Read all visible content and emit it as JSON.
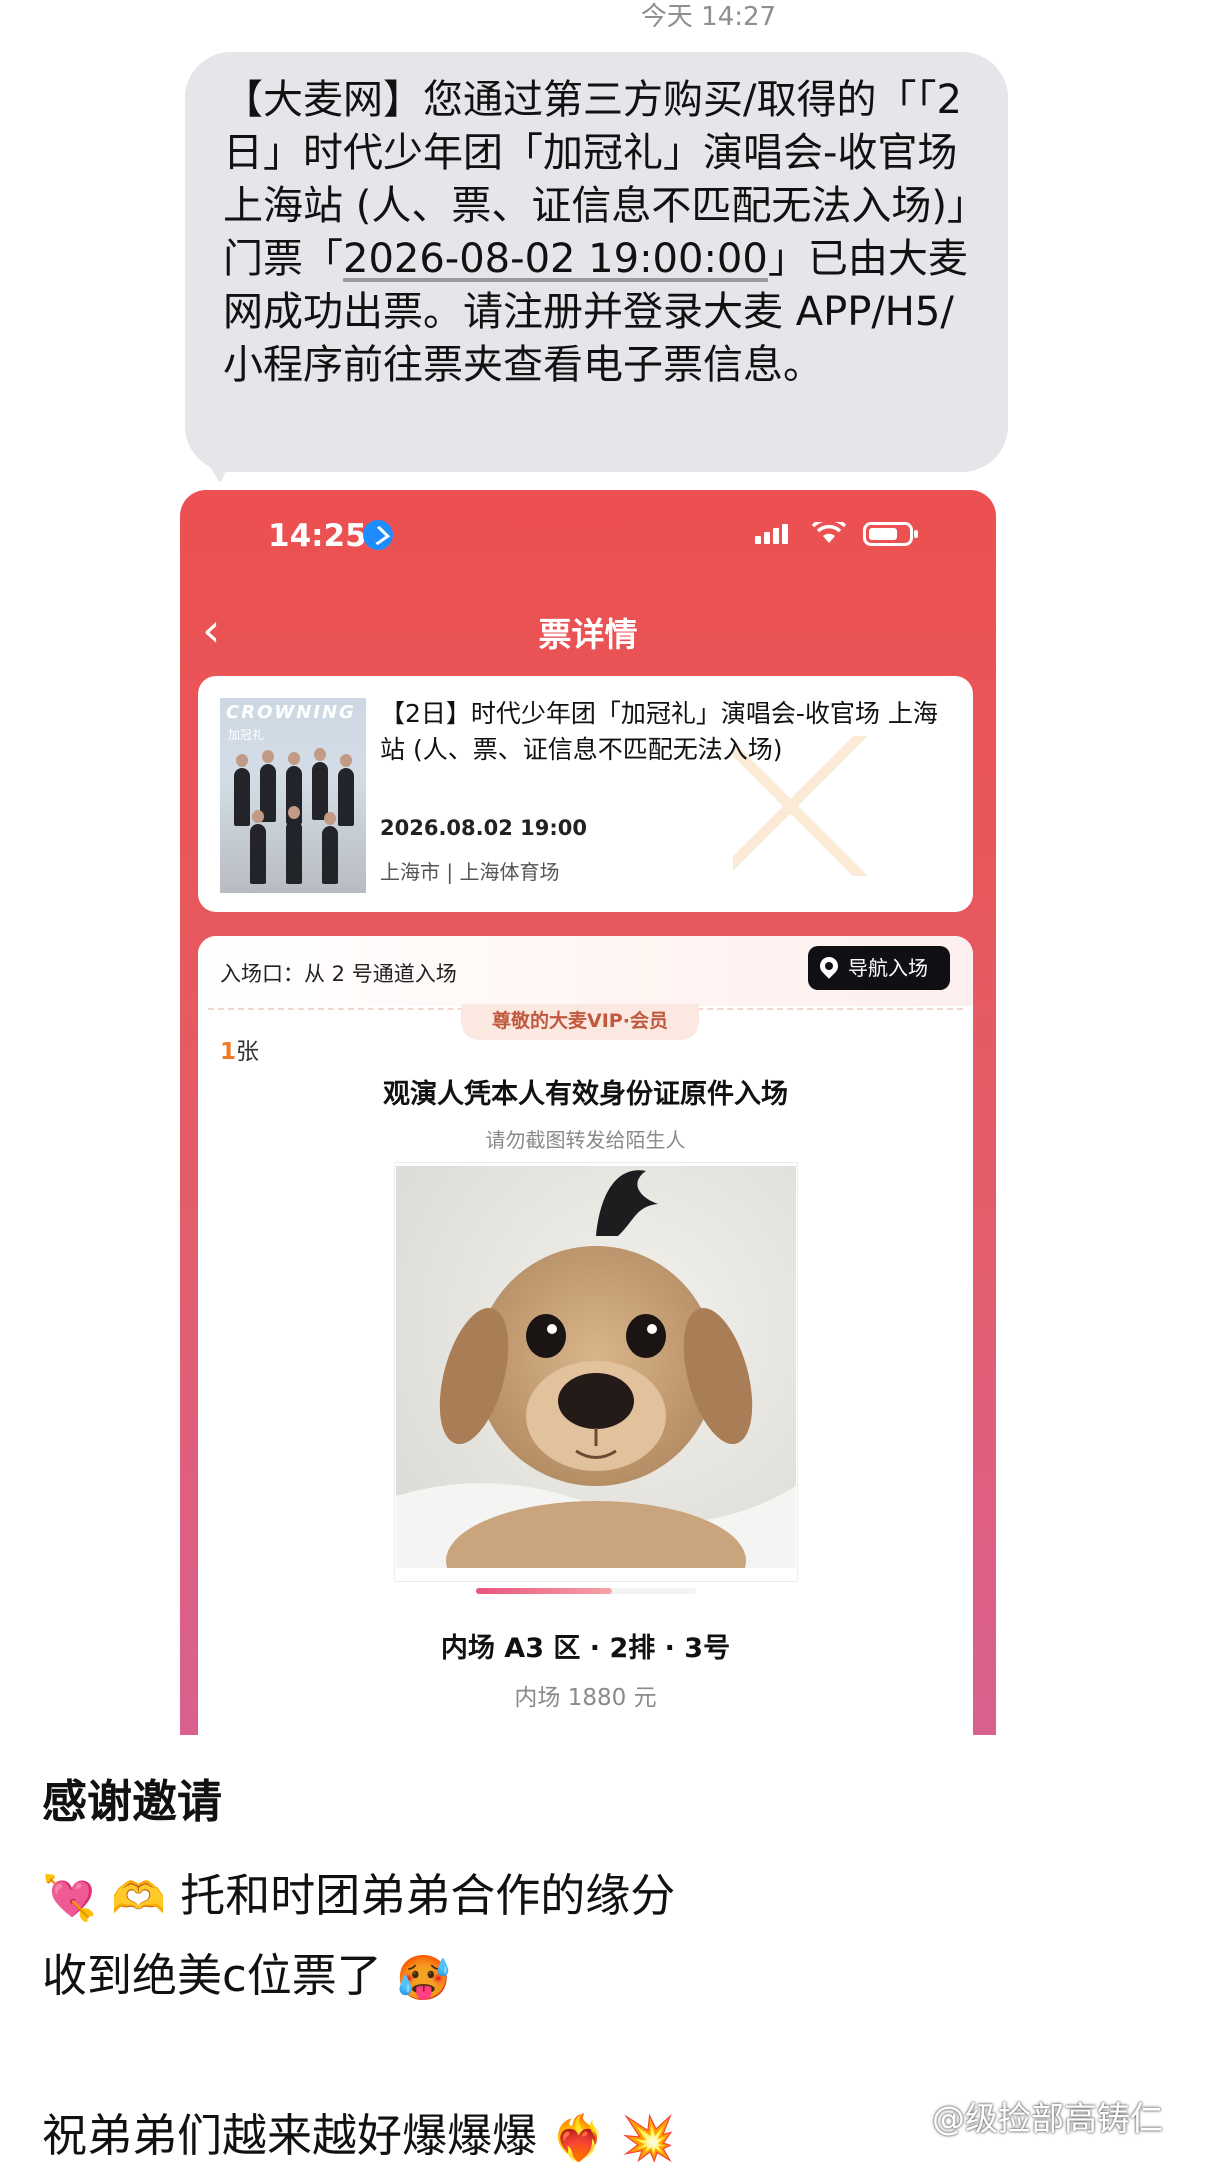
{
  "sms": {
    "timestamp": "今天 14:27",
    "message_part1": "【大麦网】您通过第三方购买/取得的「「2日」时代少年团「加冠礼」演唱会-收官场 上海站 (人、票、证信息不匹配无法入场)」门票「",
    "message_datetime": "2026-08-02 19:00:00",
    "message_part2": "」已由大麦网成功出票。请注册并登录大麦 APP/H5/小程序前往票夹查看电子票信息。"
  },
  "phone": {
    "status_time": "14:25",
    "nav_title": "票详情",
    "back_symbol": "‹",
    "event": {
      "poster_logo": "CROWNING",
      "poster_sub": "加冠礼",
      "title": "【2日】时代少年团「加冠礼」演唱会-收官场 上海站 (人、票、证信息不匹配无法入场)",
      "date": "2026.08.02 19:00",
      "venue": "上海市 | 上海体育场"
    },
    "ticket": {
      "entrance": "入场口：从 2 号通道入场",
      "nav_button": "导航入场",
      "vip_badge": "尊敬的大麦VIP·会员",
      "count_num": "1",
      "count_unit": "张",
      "id_rule": "观演人凭本人有效身份证原件入场",
      "warning": "请勿截图转发给陌生人",
      "progress": 0.62,
      "seat": "内场 A3 区 · 2排 · 3号",
      "price": "内场 1880 元"
    }
  },
  "post": {
    "title": "感谢邀请",
    "line1_emoji": [
      "💘",
      "🫶"
    ],
    "line1_text": "托和时团弟弟合作的缘分",
    "line2_text": "收到绝美c位票了",
    "line2_emoji": "🥵",
    "line3_text": "祝弟弟们越来越好爆爆爆",
    "line3_emoji": [
      "❤️‍🔥",
      "💥"
    ]
  },
  "watermark": "@级捡部高铸仁",
  "colors": {
    "bubble": "#e5e5ea",
    "phone_top": "#ec5051",
    "phone_bottom": "#d9608f",
    "accent_orange": "#ef7a27",
    "nav_button": "#0f0f14"
  }
}
